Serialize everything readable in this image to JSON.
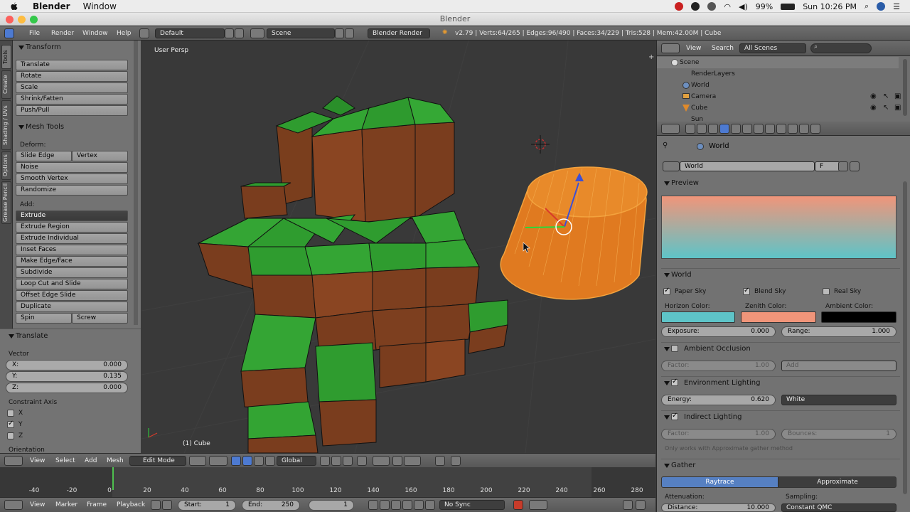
{
  "mac": {
    "app": "Blender",
    "menu_window": "Window",
    "battery": "99%",
    "clock": "Sun 10:26 PM"
  },
  "window_title": "Blender",
  "header": {
    "menus": [
      "File",
      "Render",
      "Window",
      "Help"
    ],
    "layout": "Default",
    "scene": "Scene",
    "engine": "Blender Render",
    "stats": "v2.79 | Verts:64/265 | Edges:96/490 | Faces:34/229 | Tris:528 | Mem:42.00M | Cube"
  },
  "tabs": [
    "Tools",
    "Create",
    "Shading / UVs",
    "Options",
    "Grease Pencil"
  ],
  "tools": {
    "transform_title": "Transform",
    "transform": [
      "Translate",
      "Rotate",
      "Scale",
      "Shrink/Fatten",
      "Push/Pull"
    ],
    "mesh_title": "Mesh Tools",
    "deform_label": "Deform:",
    "slide_edge": "Slide Edge",
    "vertex": "Vertex",
    "deform": [
      "Noise",
      "Smooth Vertex",
      "Randomize"
    ],
    "add_label": "Add:",
    "extrude": "Extrude",
    "add": [
      "Extrude Region",
      "Extrude Individual",
      "Inset Faces",
      "Make Edge/Face",
      "Subdivide",
      "Loop Cut and Slide",
      "Offset Edge Slide",
      "Duplicate"
    ],
    "spin": "Spin",
    "screw": "Screw"
  },
  "redo": {
    "title": "Translate",
    "vector_label": "Vector",
    "x_label": "X:",
    "x": "0.000",
    "y_label": "Y:",
    "y": "0.135",
    "z_label": "Z:",
    "z": "0.000",
    "constraint_label": "Constraint Axis",
    "cx": "X",
    "cy": "Y",
    "cz": "Z",
    "orientation_label": "Orientation"
  },
  "viewport": {
    "label": "User Persp",
    "object": "(1) Cube"
  },
  "view_header": {
    "menus": [
      "View",
      "Select",
      "Add",
      "Mesh"
    ],
    "mode": "Edit Mode",
    "orientation": "Global"
  },
  "timeline": {
    "ticks": [
      "-40",
      "-20",
      "0",
      "20",
      "40",
      "60",
      "80",
      "100",
      "120",
      "140",
      "160",
      "180",
      "200",
      "220",
      "240",
      "260",
      "280"
    ],
    "menus": [
      "View",
      "Marker",
      "Frame",
      "Playback"
    ],
    "start_label": "Start:",
    "start": "1",
    "end_label": "End:",
    "end": "250",
    "current": "1",
    "sync": "No Sync"
  },
  "outliner": {
    "view": "View",
    "search": "Search",
    "filter": "All Scenes",
    "items": [
      "Scene",
      "RenderLayers",
      "World",
      "Camera",
      "Cube",
      "Sun"
    ]
  },
  "properties": {
    "breadcrumb": "World",
    "world_name": "World",
    "fake_user": "F",
    "preview_title": "Preview",
    "world_title": "World",
    "paper_sky": "Paper Sky",
    "blend_sky": "Blend Sky",
    "real_sky": "Real Sky",
    "horizon_label": "Horizon Color:",
    "zenith_label": "Zenith Color:",
    "ambient_label": "Ambient Color:",
    "horizon_color": "#5ec4c8",
    "zenith_color": "#f0957a",
    "ambient_color": "#000000",
    "exposure_label": "Exposure:",
    "exposure": "0.000",
    "range_label": "Range:",
    "range": "1.000",
    "ao_title": "Ambient Occlusion",
    "factor_label": "Factor:",
    "ao_factor": "1.00",
    "ao_blend": "Add",
    "env_title": "Environment Lighting",
    "energy_label": "Energy:",
    "energy": "0.620",
    "env_color": "White",
    "indirect_title": "Indirect Lighting",
    "ind_factor": "1.00",
    "bounces_label": "Bounces:",
    "bounces": "1",
    "indirect_note": "Only works with Approximate gather method",
    "gather_title": "Gather",
    "raytrace": "Raytrace",
    "approximate": "Approximate",
    "attenuation_label": "Attenuation:",
    "sampling_label": "Sampling:",
    "distance_label": "Distance:",
    "distance": "10.000",
    "sampling": "Constant QMC"
  }
}
